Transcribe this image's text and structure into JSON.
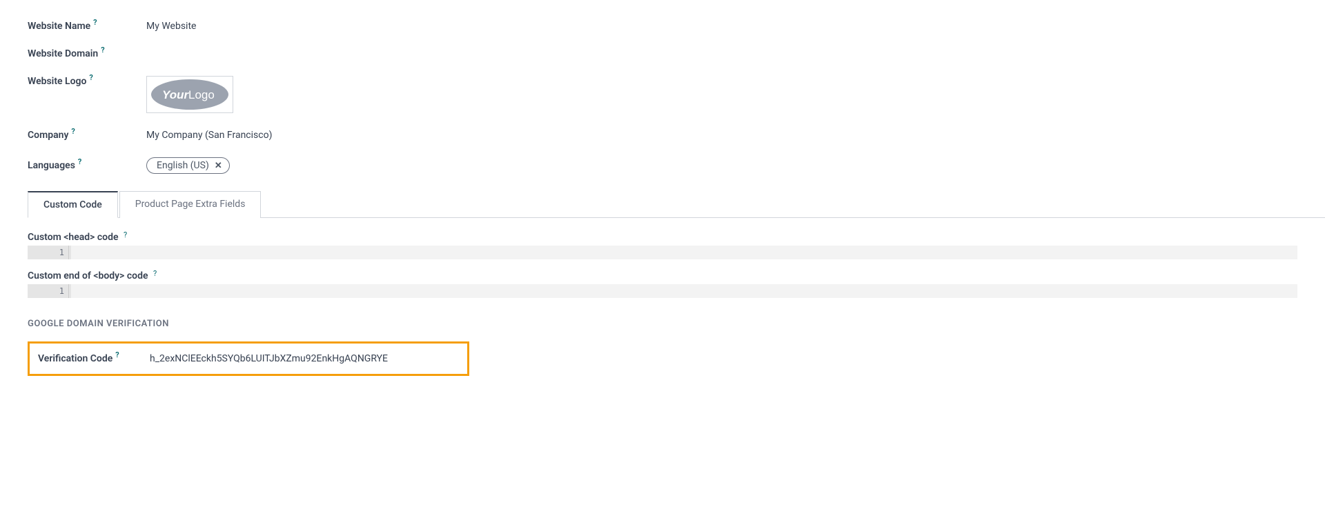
{
  "form": {
    "website_name": {
      "label": "Website Name",
      "value": "My Website"
    },
    "website_domain": {
      "label": "Website Domain",
      "value": ""
    },
    "website_logo": {
      "label": "Website Logo"
    },
    "company": {
      "label": "Company",
      "value": "My Company (San Francisco)"
    },
    "languages": {
      "label": "Languages",
      "tag": "English (US)"
    }
  },
  "tabs": {
    "custom_code": "Custom Code",
    "product_page_extra_fields": "Product Page Extra Fields"
  },
  "custom_code": {
    "head_label": "Custom <head> code",
    "body_label": "Custom end of <body> code",
    "line_number": "1"
  },
  "verification": {
    "section_title": "GOOGLE DOMAIN VERIFICATION",
    "label": "Verification Code",
    "value": "h_2exNClEEckh5SYQb6LUITJbXZmu92EnkHgAQNGRYE"
  },
  "help_glyph": "?"
}
